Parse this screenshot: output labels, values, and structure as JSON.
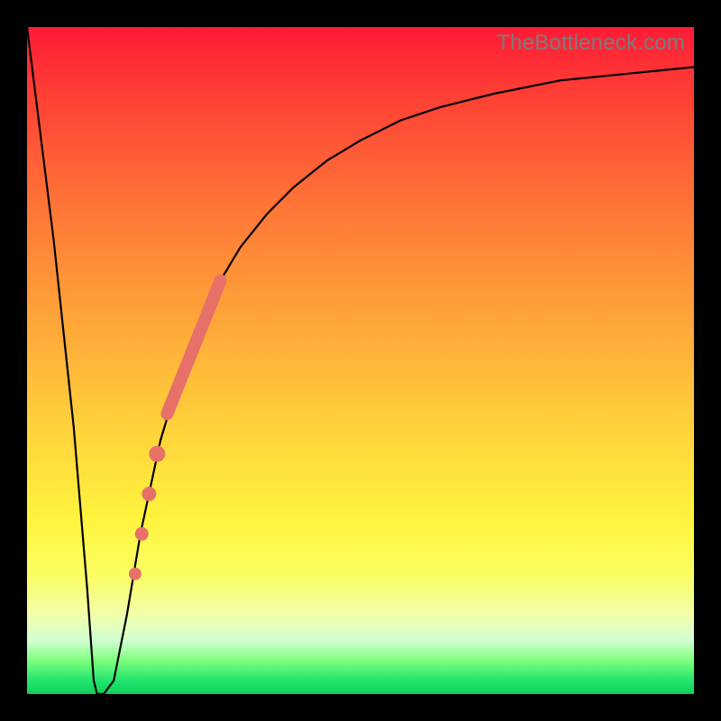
{
  "watermark": "TheBottleneck.com",
  "colors": {
    "frame": "#000000",
    "gradient_top": "#fe1a36",
    "gradient_mid": "#ffd23b",
    "gradient_bottom": "#0fcf5a",
    "curve": "#000000",
    "highlight": "#e77169"
  },
  "chart_data": {
    "type": "line",
    "title": "",
    "xlabel": "",
    "ylabel": "",
    "xlim": [
      0,
      100
    ],
    "ylim": [
      0,
      100
    ],
    "grid": false,
    "legend": false,
    "series": [
      {
        "name": "bottleneck-curve",
        "x": [
          0,
          4,
          7,
          9,
          10,
          10.5,
          11.5,
          13,
          15,
          17,
          20,
          23,
          26,
          29,
          32,
          36,
          40,
          45,
          50,
          56,
          62,
          70,
          80,
          90,
          100
        ],
        "y": [
          100,
          68,
          40,
          16,
          2,
          0,
          0,
          2,
          12,
          24,
          38,
          48,
          56,
          62,
          67,
          72,
          76,
          80,
          83,
          86,
          88,
          90,
          92,
          93,
          94
        ]
      }
    ],
    "highlighted_band": {
      "name": "highlight-segment",
      "x_start": 21,
      "x_end": 29,
      "y_start": 42,
      "y_end": 62
    },
    "highlighted_points": [
      {
        "x": 19.5,
        "y": 36
      },
      {
        "x": 18.3,
        "y": 30
      },
      {
        "x": 17.2,
        "y": 24
      },
      {
        "x": 16.2,
        "y": 18
      }
    ]
  }
}
